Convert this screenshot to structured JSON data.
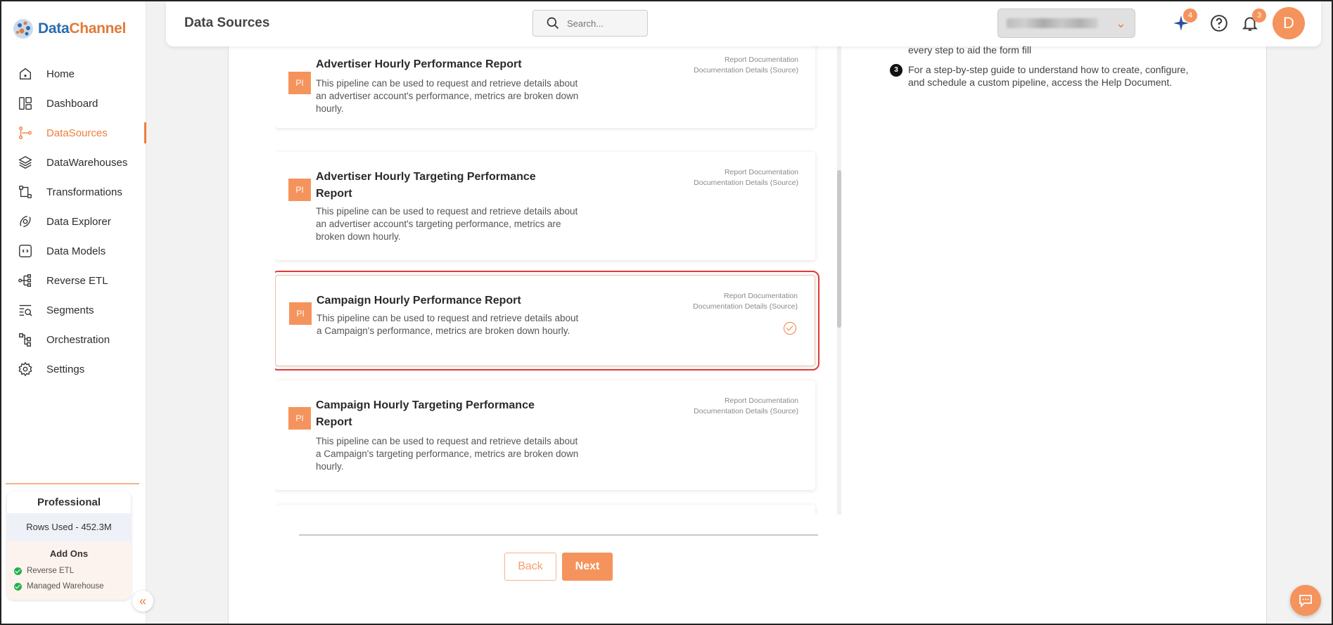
{
  "app": {
    "logo_part1": "Data",
    "logo_part2": "Channel"
  },
  "header": {
    "title": "Data Sources",
    "search_placeholder": "Search...",
    "sparkle_badge": "4",
    "notifications_badge": "3",
    "avatar_initial": "D"
  },
  "sidebar": {
    "items": [
      {
        "label": "Home",
        "icon": "home-icon"
      },
      {
        "label": "Dashboard",
        "icon": "dashboard-icon"
      },
      {
        "label": "DataSources",
        "icon": "datasources-icon",
        "active": true
      },
      {
        "label": "DataWarehouses",
        "icon": "layers-icon"
      },
      {
        "label": "Transformations",
        "icon": "transform-icon"
      },
      {
        "label": "Data Explorer",
        "icon": "explorer-icon"
      },
      {
        "label": "Data Models",
        "icon": "models-icon"
      },
      {
        "label": "Reverse ETL",
        "icon": "reverse-etl-icon"
      },
      {
        "label": "Segments",
        "icon": "segments-icon"
      },
      {
        "label": "Orchestration",
        "icon": "orchestration-icon"
      },
      {
        "label": "Settings",
        "icon": "gear-icon"
      }
    ],
    "plan": {
      "title": "Professional",
      "rows_used": "Rows Used - 452.3M",
      "addons_title": "Add Ons",
      "addons": [
        "Reverse ETL",
        "Managed Warehouse"
      ]
    }
  },
  "reports": [
    {
      "badge": "PI",
      "title": "Advertiser Hourly Performance Report",
      "description": "This pipeline can be used to request and retrieve details about an advertiser account's performance, metrics are broken down hourly.",
      "doc_link_1": "Report Documentation",
      "doc_link_2": "Documentation Details (Source)",
      "selected": false
    },
    {
      "badge": "PI",
      "title": "Advertiser Hourly Targeting Performance Report",
      "description": "This pipeline can be used to request and retrieve details about an advertiser account's targeting performance, metrics are broken down hourly.",
      "doc_link_1": "Report Documentation",
      "doc_link_2": "Documentation Details (Source)",
      "selected": false
    },
    {
      "badge": "PI",
      "title": "Campaign Hourly Performance Report",
      "description": "This pipeline can be used to request and retrieve details about a Campaign's performance, metrics are broken down hourly.",
      "doc_link_1": "Report Documentation",
      "doc_link_2": "Documentation Details (Source)",
      "selected": true
    },
    {
      "badge": "PI",
      "title": "Campaign Hourly Targeting Performance Report",
      "description": "This pipeline can be used to request and retrieve details about a Campaign's targeting performance, metrics are broken down hourly.",
      "doc_link_1": "Report Documentation",
      "doc_link_2": "Documentation Details (Source)",
      "selected": false
    }
  ],
  "actions": {
    "back_label": "Back",
    "next_label": "Next"
  },
  "help": {
    "partial_line": "every step to aid the form fill",
    "step3_number": "3",
    "step3_line1": "For a step-by-step guide to understand how to create, configure,",
    "step3_line2": "and schedule a custom pipeline, access the Help Document."
  }
}
